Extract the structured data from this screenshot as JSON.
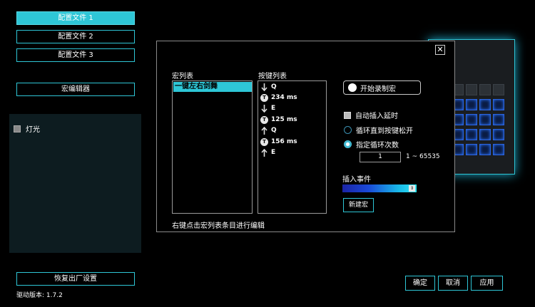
{
  "profiles": [
    "配置文件 1",
    "配置文件 2",
    "配置文件 3"
  ],
  "macro_editor_label": "宏编辑器",
  "left_panel": {
    "lighting_label": "灯光"
  },
  "factory_reset_label": "恢复出厂设置",
  "driver_version": "驱动版本:  1.7.2",
  "dialog": {
    "close": "✕",
    "macro_list_title": "宏列表",
    "macros": [
      "一键左右剑舞"
    ],
    "key_list_title": "按键列表",
    "keys": [
      {
        "icon": "arrow-down-icon",
        "text": "Q"
      },
      {
        "icon": "timer-icon",
        "text": "234 ms"
      },
      {
        "icon": "arrow-down-icon",
        "text": "E"
      },
      {
        "icon": "timer-icon",
        "text": "125 ms"
      },
      {
        "icon": "arrow-up-icon",
        "text": "Q"
      },
      {
        "icon": "timer-icon",
        "text": "156 ms"
      },
      {
        "icon": "arrow-up-icon",
        "text": "E"
      }
    ],
    "record_label": "开始录制宏",
    "auto_delay_label": "自动插入延时",
    "loop_until_release_label": "循环直到按键松开",
    "loop_count_label": "指定循环次数",
    "loop_count_value": "1",
    "loop_range": "1 ~ 65535",
    "insert_event_label": "插入事件",
    "new_macro_label": "新建宏",
    "hint": "右键点击宏列表条目进行编辑"
  },
  "bottom_buttons": {
    "ok": "确定",
    "cancel": "取消",
    "apply": "应用"
  },
  "colors": {
    "accent": "#2ec6d6",
    "background": "#000000"
  }
}
